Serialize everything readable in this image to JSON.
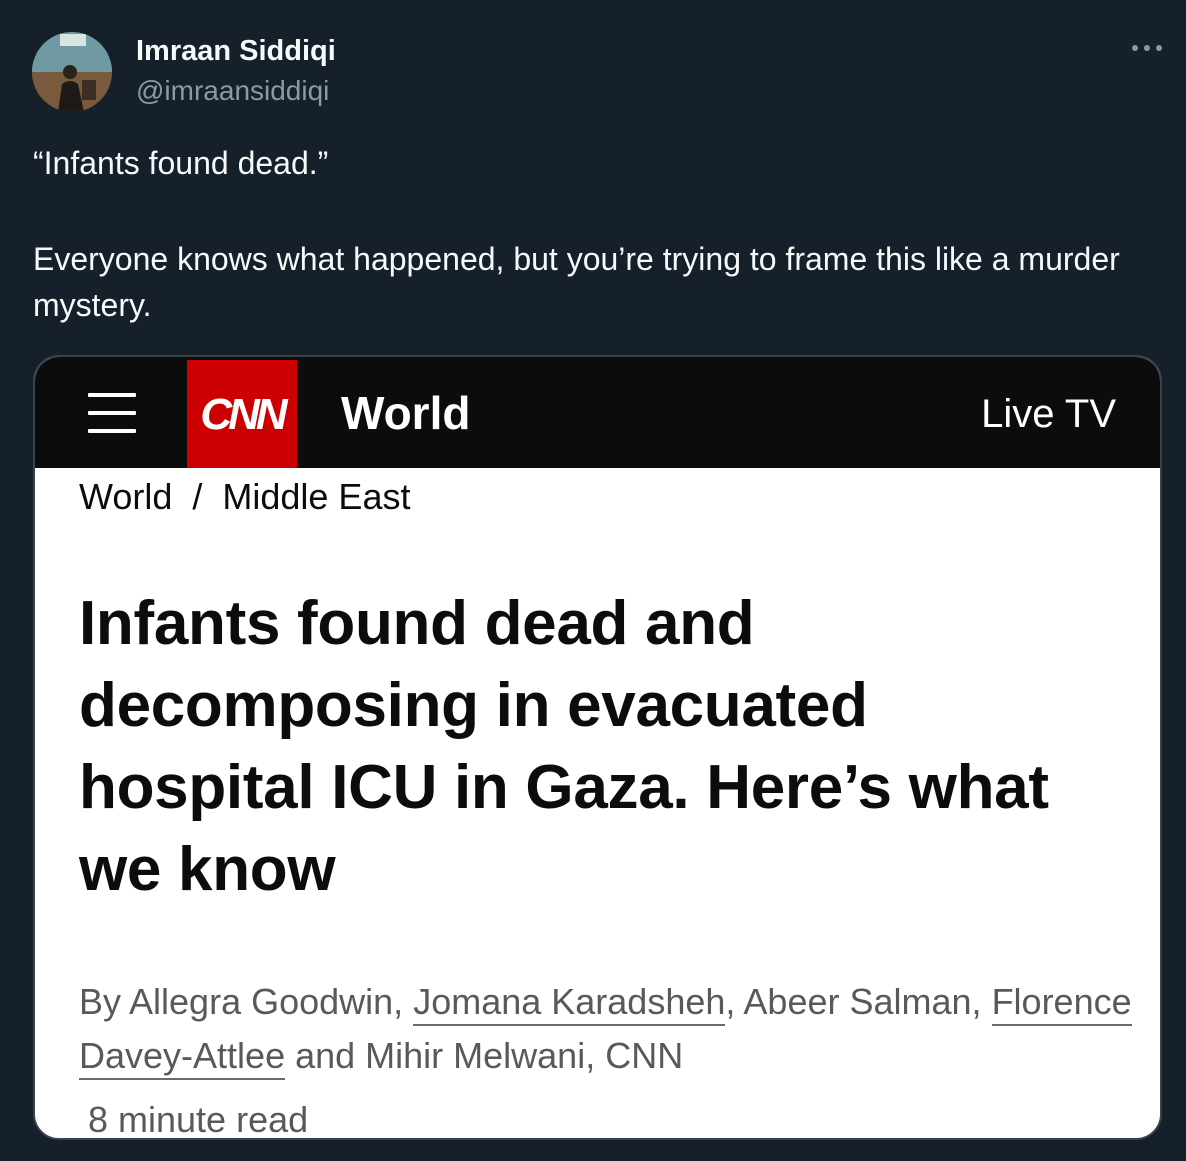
{
  "author": {
    "name": "Imraan Siddiqi",
    "handle": "@imraansiddiqi"
  },
  "tweet": {
    "line1": "“Infants found dead.”",
    "line2": "Everyone knows what happened, but you’re trying to frame this like a murder mystery."
  },
  "icons": {
    "more": "more-horizontal-icon",
    "menu": "hamburger-menu-icon",
    "logo": "cnn-logo"
  },
  "card": {
    "logo_text": "CNN",
    "section": "World",
    "live_tv": "Live TV",
    "breadcrumb": {
      "first": "World",
      "separator": "/",
      "second": "Middle East"
    },
    "headline": "Infants found dead and decomposing in evacuated hospital ICU in Gaza. Here’s what we know",
    "byline": {
      "prefix": "By Allegra Goodwin, ",
      "author2": "Jomana Karadsheh",
      "middle": ", Abeer Salman, ",
      "author4": "Florence Davey-Attlee",
      "suffix": " and Mihir Melwani, CNN"
    },
    "read_time": "8 minute read"
  },
  "colors": {
    "background": "#15202b",
    "text_primary": "#f7f9f9",
    "text_secondary": "#8b98a5",
    "cnn_red": "#cc0000",
    "cnn_header": "#0c0c0c"
  }
}
